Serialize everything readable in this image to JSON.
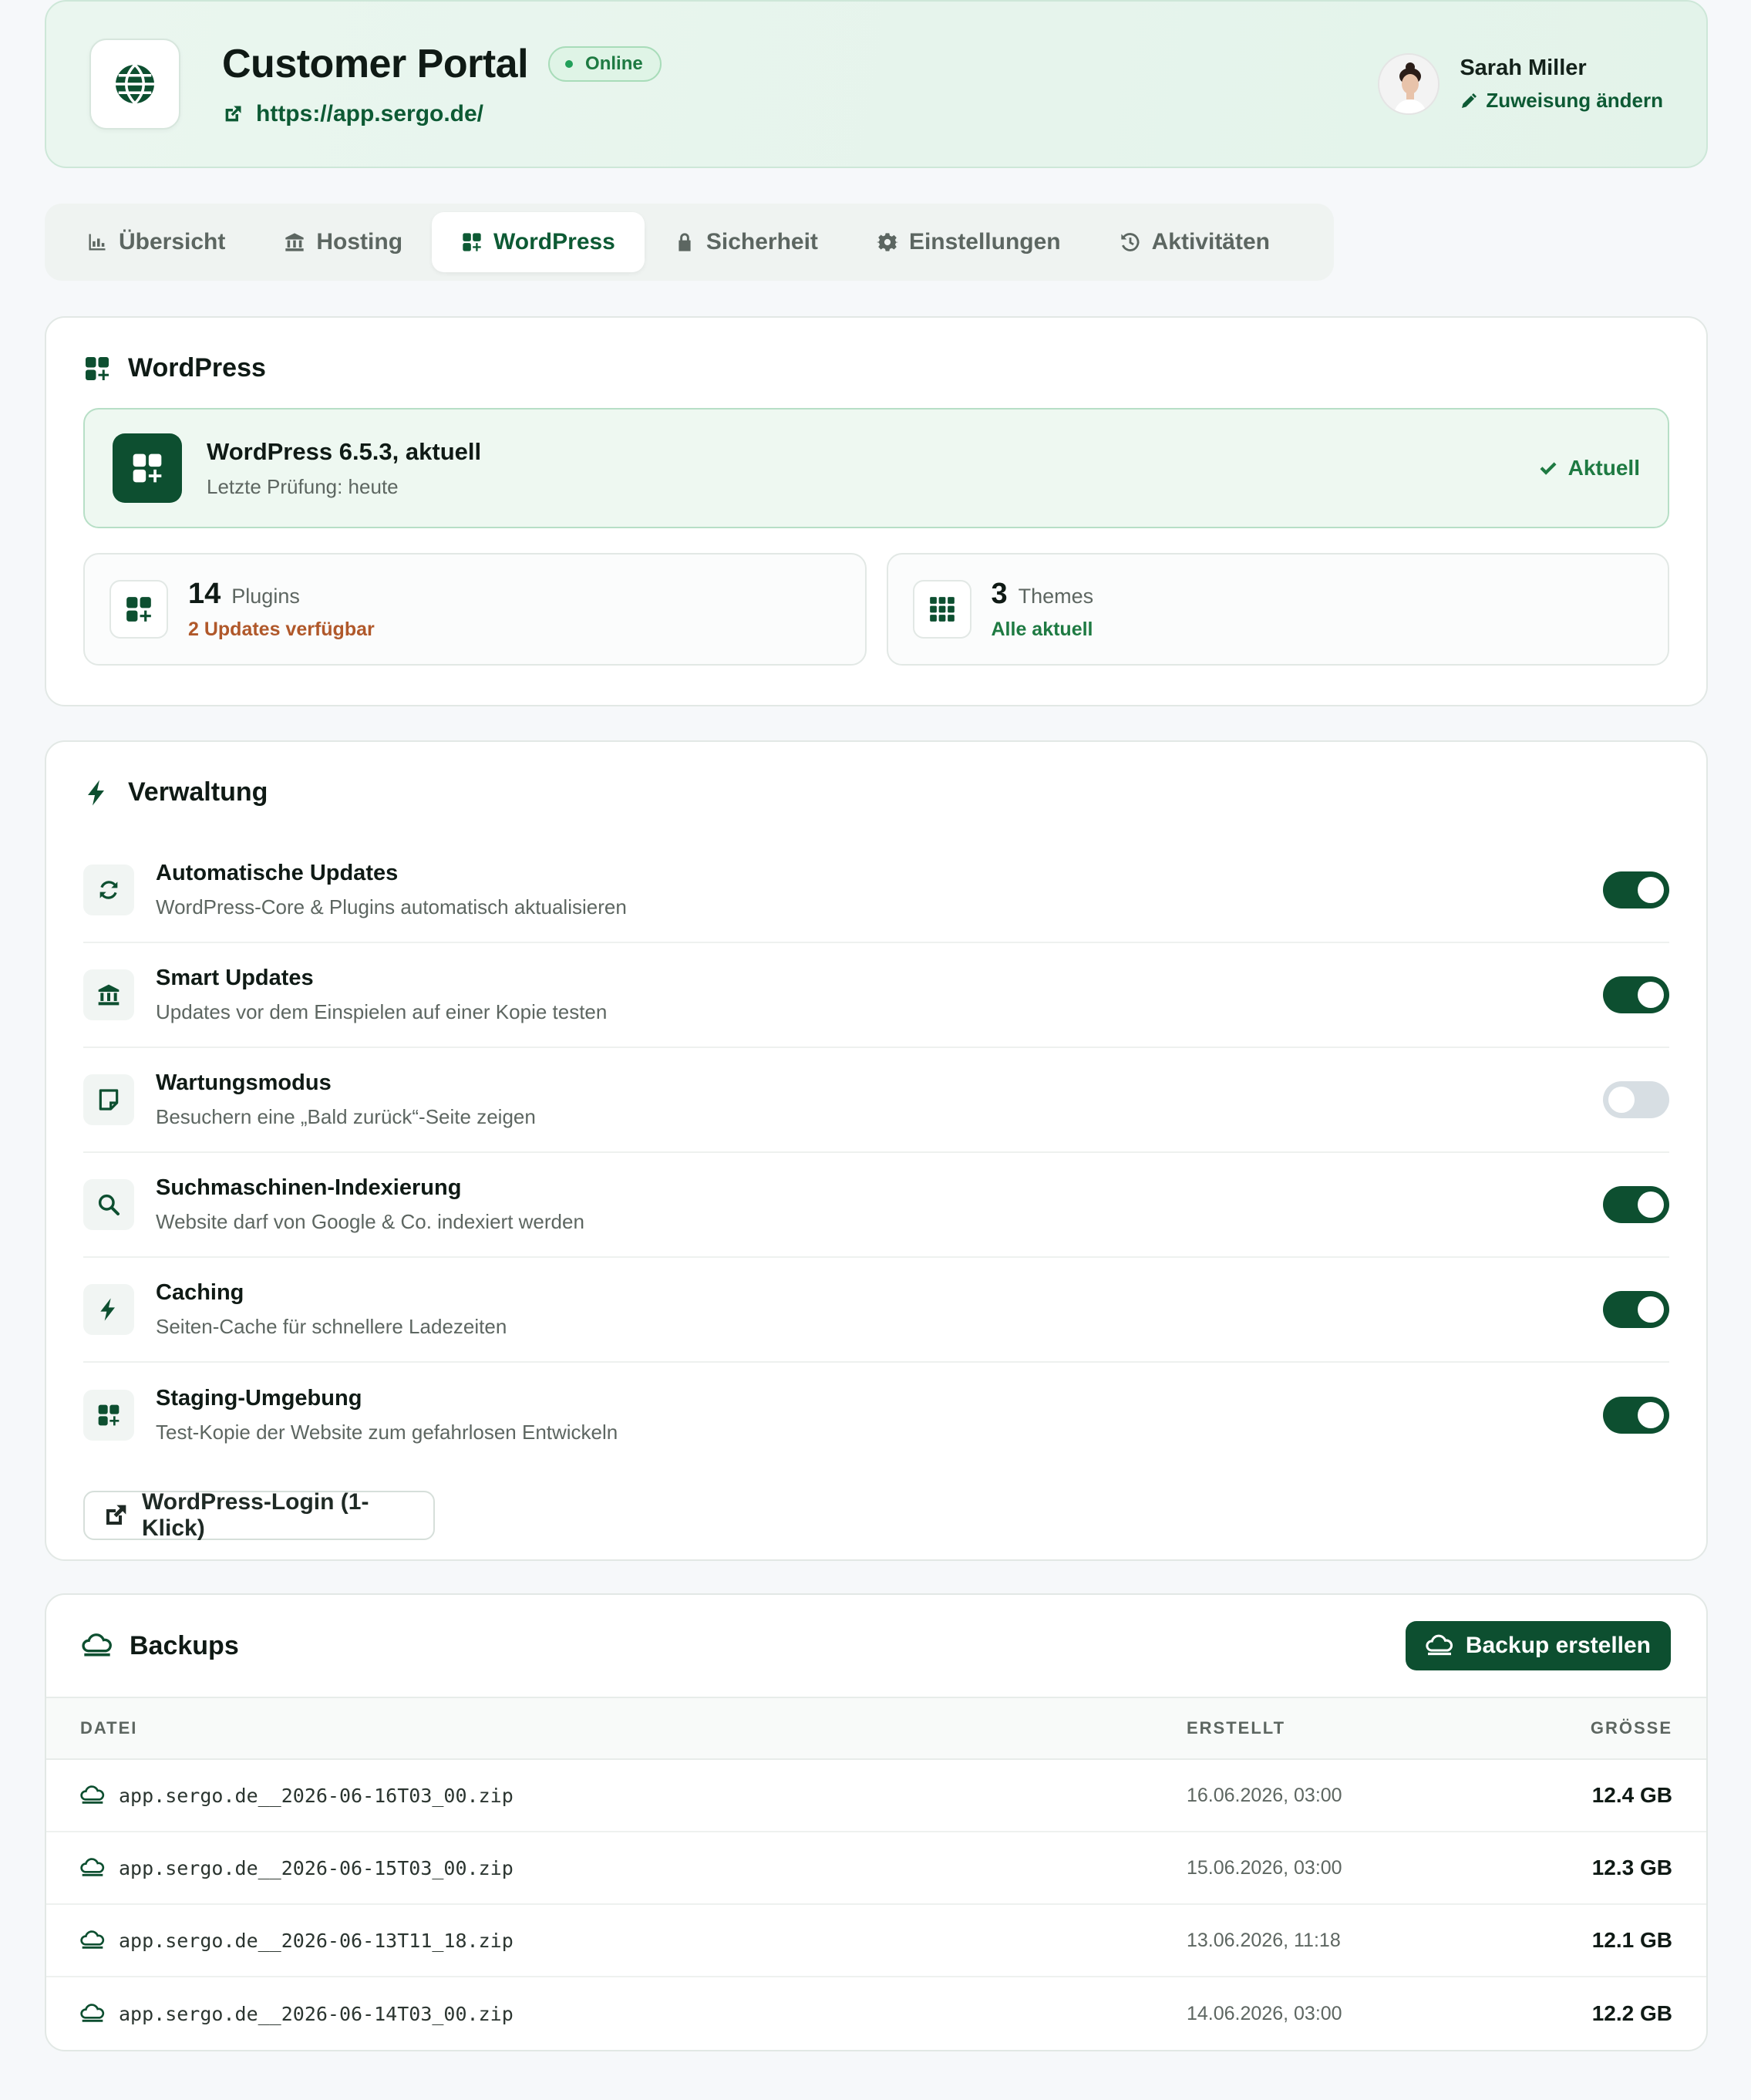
{
  "header": {
    "title": "Customer Portal",
    "status": "Online",
    "url": "https://app.sergo.de/",
    "user_name": "Sarah Miller",
    "change_assignment": "Zuweisung ändern"
  },
  "tabs": [
    {
      "label": "Übersicht",
      "icon": "chart-bar-icon",
      "active": false
    },
    {
      "label": "Hosting",
      "icon": "building-columns-icon",
      "active": false
    },
    {
      "label": "WordPress",
      "icon": "grid-plus-icon",
      "active": true
    },
    {
      "label": "Sicherheit",
      "icon": "lock-icon",
      "active": false
    },
    {
      "label": "Einstellungen",
      "icon": "gear-icon",
      "active": false
    },
    {
      "label": "Aktivitäten",
      "icon": "history-icon",
      "active": false
    }
  ],
  "wordpress": {
    "section_title": "WordPress",
    "version_title": "WordPress 6.5.3, aktuell",
    "last_check": "Letzte Prüfung: heute",
    "status_label": "Aktuell",
    "plugins": {
      "count": "14",
      "label": "Plugins",
      "sub": "2 Updates verfügbar"
    },
    "themes": {
      "count": "3",
      "label": "Themes",
      "sub": "Alle aktuell"
    }
  },
  "management": {
    "section_title": "Verwaltung",
    "items": [
      {
        "title": "Automatische Updates",
        "desc": "WordPress-Core & Plugins automatisch aktualisieren",
        "enabled": true,
        "icon": "refresh-icon"
      },
      {
        "title": "Smart Updates",
        "desc": "Updates vor dem Einspielen auf einer Kopie testen",
        "enabled": true,
        "icon": "building-columns-icon"
      },
      {
        "title": "Wartungsmodus",
        "desc": "Besuchern eine „Bald zurück“-Seite zeigen",
        "enabled": false,
        "icon": "note-icon"
      },
      {
        "title": "Suchmaschinen-Indexierung",
        "desc": "Website darf von Google & Co. indexiert werden",
        "enabled": true,
        "icon": "search-icon"
      },
      {
        "title": "Caching",
        "desc": "Seiten-Cache für schnellere Ladezeiten",
        "enabled": true,
        "icon": "bolt-icon"
      },
      {
        "title": "Staging-Umgebung",
        "desc": "Test-Kopie der Website zum gefahrlosen Entwickeln",
        "enabled": true,
        "icon": "grid-plus-icon"
      }
    ],
    "login_button": "WordPress-Login (1-Klick)"
  },
  "backups": {
    "section_title": "Backups",
    "create_button": "Backup erstellen",
    "columns": {
      "file": "DATEI",
      "created": "ERSTELLT",
      "size": "GRÖSSE"
    },
    "rows": [
      {
        "file": "app.sergo.de__2026-06-16T03_00.zip",
        "created": "16.06.2026, 03:00",
        "size": "12.4 GB"
      },
      {
        "file": "app.sergo.de__2026-06-15T03_00.zip",
        "created": "15.06.2026, 03:00",
        "size": "12.3 GB"
      },
      {
        "file": "app.sergo.de__2026-06-13T11_18.zip",
        "created": "13.06.2026, 11:18",
        "size": "12.1 GB"
      },
      {
        "file": "app.sergo.de__2026-06-14T03_00.zip",
        "created": "14.06.2026, 03:00",
        "size": "12.2 GB"
      }
    ]
  },
  "colors": {
    "accent": "#0d4f30",
    "ok": "#1e7a42",
    "warn": "#b0582a"
  }
}
